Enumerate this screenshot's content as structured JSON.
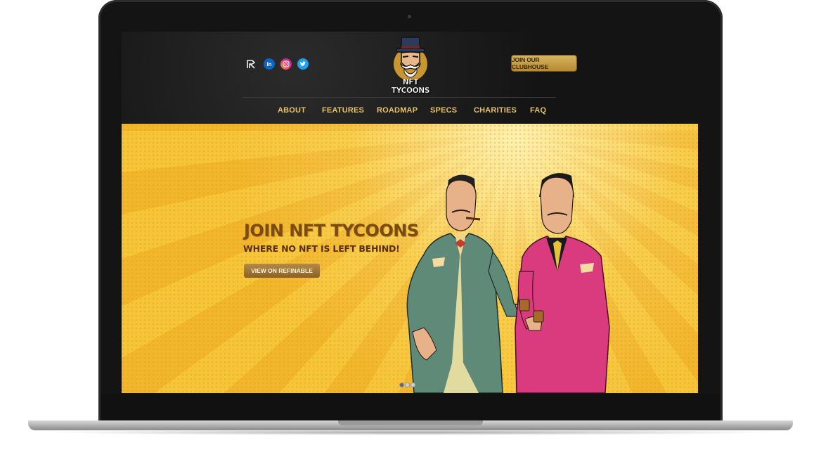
{
  "social": {
    "refinable_icon": "refinable-icon",
    "linkedin": "in",
    "instagram_icon": "instagram-icon",
    "twitter_icon": "twitter-icon"
  },
  "logo": {
    "text": "NFT TYCOONS"
  },
  "header": {
    "cta_label": "JOIN OUR CLUBHOUSE"
  },
  "nav": {
    "items": [
      {
        "label": "ABOUT"
      },
      {
        "label": "FEATURES"
      },
      {
        "label": "ROADMAP"
      },
      {
        "label": "SPECS"
      },
      {
        "label": "CHARITIES"
      },
      {
        "label": "FAQ"
      }
    ]
  },
  "hero": {
    "title": "JOIN NFT TYCOONS",
    "subtitle": "WHERE NO NFT IS LEFT BEHIND!",
    "cta_label": "VIEW ON REFINABLE",
    "slides": 3,
    "active_slide": 1
  },
  "colors": {
    "accent_gold": "#e6c26c",
    "hero_yellow": "#f6c53a",
    "title_brown": "#7a4b12"
  }
}
